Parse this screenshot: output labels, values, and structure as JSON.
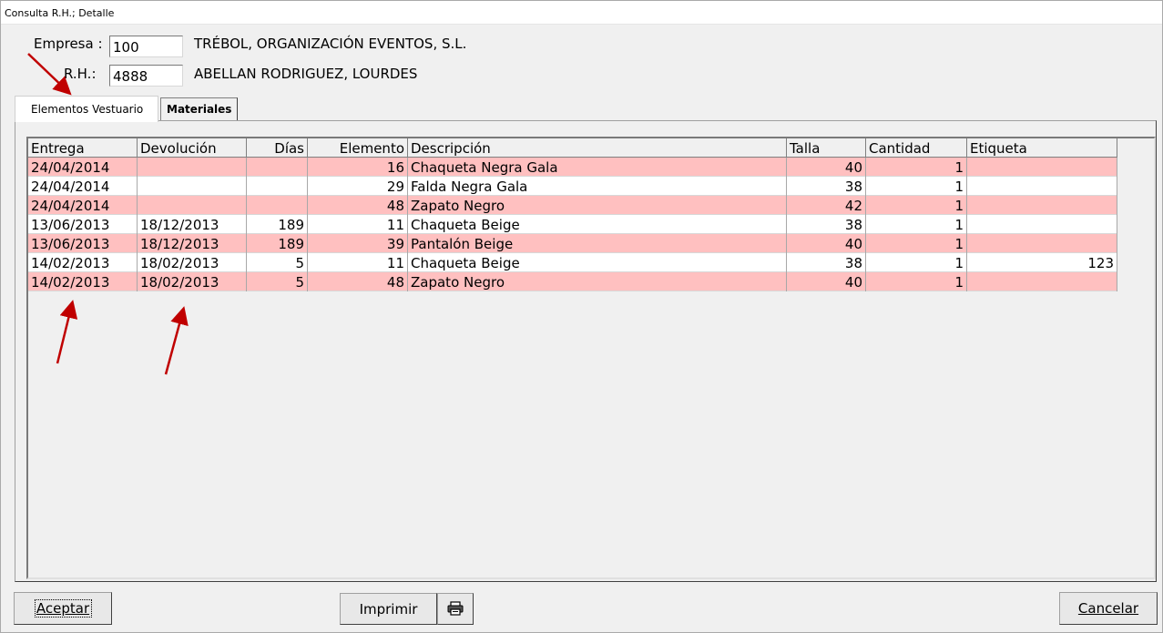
{
  "window": {
    "title": "Consulta R.H.; Detalle"
  },
  "empresa": {
    "label": "Empresa :",
    "code": "100",
    "name": "TRÉBOL, ORGANIZACIÓN EVENTOS, S.L."
  },
  "rh": {
    "label": "R.H.:",
    "code": "4888",
    "name": "ABELLAN RODRIGUEZ, LOURDES"
  },
  "tabs": [
    {
      "label": "Elementos Vestuario",
      "active": true
    },
    {
      "label": "Materiales",
      "active": false
    }
  ],
  "table": {
    "headers": [
      "Entrega",
      "Devolución",
      "Días",
      "Elemento",
      "Descripción",
      "Talla",
      "Cantidad",
      "Etiqueta"
    ],
    "rows": [
      {
        "entrega": "24/04/2014",
        "devolucion": "",
        "dias": "",
        "elemento": "16",
        "descripcion": "Chaqueta Negra Gala",
        "talla": "40",
        "cantidad": "1",
        "etiqueta": "",
        "highlight": true
      },
      {
        "entrega": "24/04/2014",
        "devolucion": "",
        "dias": "",
        "elemento": "29",
        "descripcion": "Falda Negra Gala",
        "talla": "38",
        "cantidad": "1",
        "etiqueta": "",
        "highlight": false
      },
      {
        "entrega": "24/04/2014",
        "devolucion": "",
        "dias": "",
        "elemento": "48",
        "descripcion": "Zapato Negro",
        "talla": "42",
        "cantidad": "1",
        "etiqueta": "",
        "highlight": true
      },
      {
        "entrega": "13/06/2013",
        "devolucion": "18/12/2013",
        "dias": "189",
        "elemento": "11",
        "descripcion": "Chaqueta Beige",
        "talla": "38",
        "cantidad": "1",
        "etiqueta": "",
        "highlight": false
      },
      {
        "entrega": "13/06/2013",
        "devolucion": "18/12/2013",
        "dias": "189",
        "elemento": "39",
        "descripcion": "Pantalón Beige",
        "talla": "40",
        "cantidad": "1",
        "etiqueta": "",
        "highlight": true
      },
      {
        "entrega": "14/02/2013",
        "devolucion": "18/02/2013",
        "dias": "5",
        "elemento": "11",
        "descripcion": "Chaqueta Beige",
        "talla": "38",
        "cantidad": "1",
        "etiqueta": "123",
        "highlight": false
      },
      {
        "entrega": "14/02/2013",
        "devolucion": "18/02/2013",
        "dias": "5",
        "elemento": "48",
        "descripcion": "Zapato Negro",
        "talla": "40",
        "cantidad": "1",
        "etiqueta": "",
        "highlight": true
      }
    ]
  },
  "buttons": {
    "accept": "Aceptar",
    "print": "Imprimir",
    "printer_icon": "printer-icon",
    "cancel": "Cancelar"
  },
  "colors": {
    "highlight_row": "#ffc0c0",
    "annotation_arrow": "#c00000"
  }
}
